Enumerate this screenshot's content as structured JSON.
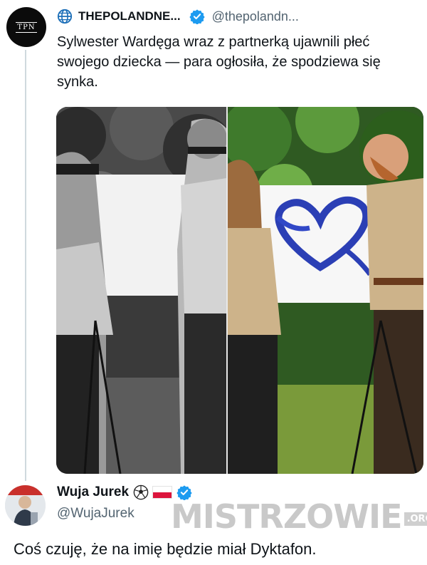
{
  "tweet": {
    "avatar_text": "TPN",
    "display_name": "THEPOLANDNE...",
    "handle": "@thepolandn...",
    "text": "Sylwester Wardęga wraz z partnerką ujawnili płeć swojego dziecka — para ogłosiła, że spodziewa się synka.",
    "media": {
      "left_panel": "grayscale photo: blindfolded couple painting on a canvas outdoors",
      "right_panel": "color photo: couple smiling in front of a canvas with a blue heart"
    }
  },
  "reply": {
    "display_name": "Wuja Jurek",
    "handle": "@WujaJurek",
    "text": "Coś czuję, że na imię będzie miał Dyktafon."
  },
  "watermark": {
    "main": "MISTRZOWIE",
    "suffix": ".ORG"
  },
  "colors": {
    "verified": "#1d9bf0",
    "text": "#0f1419",
    "secondary": "#536471",
    "thread_line": "#cfd9de"
  },
  "icons": [
    "globe-icon",
    "verified-badge-icon",
    "soccer-ball-emoji",
    "poland-flag-emoji"
  ]
}
